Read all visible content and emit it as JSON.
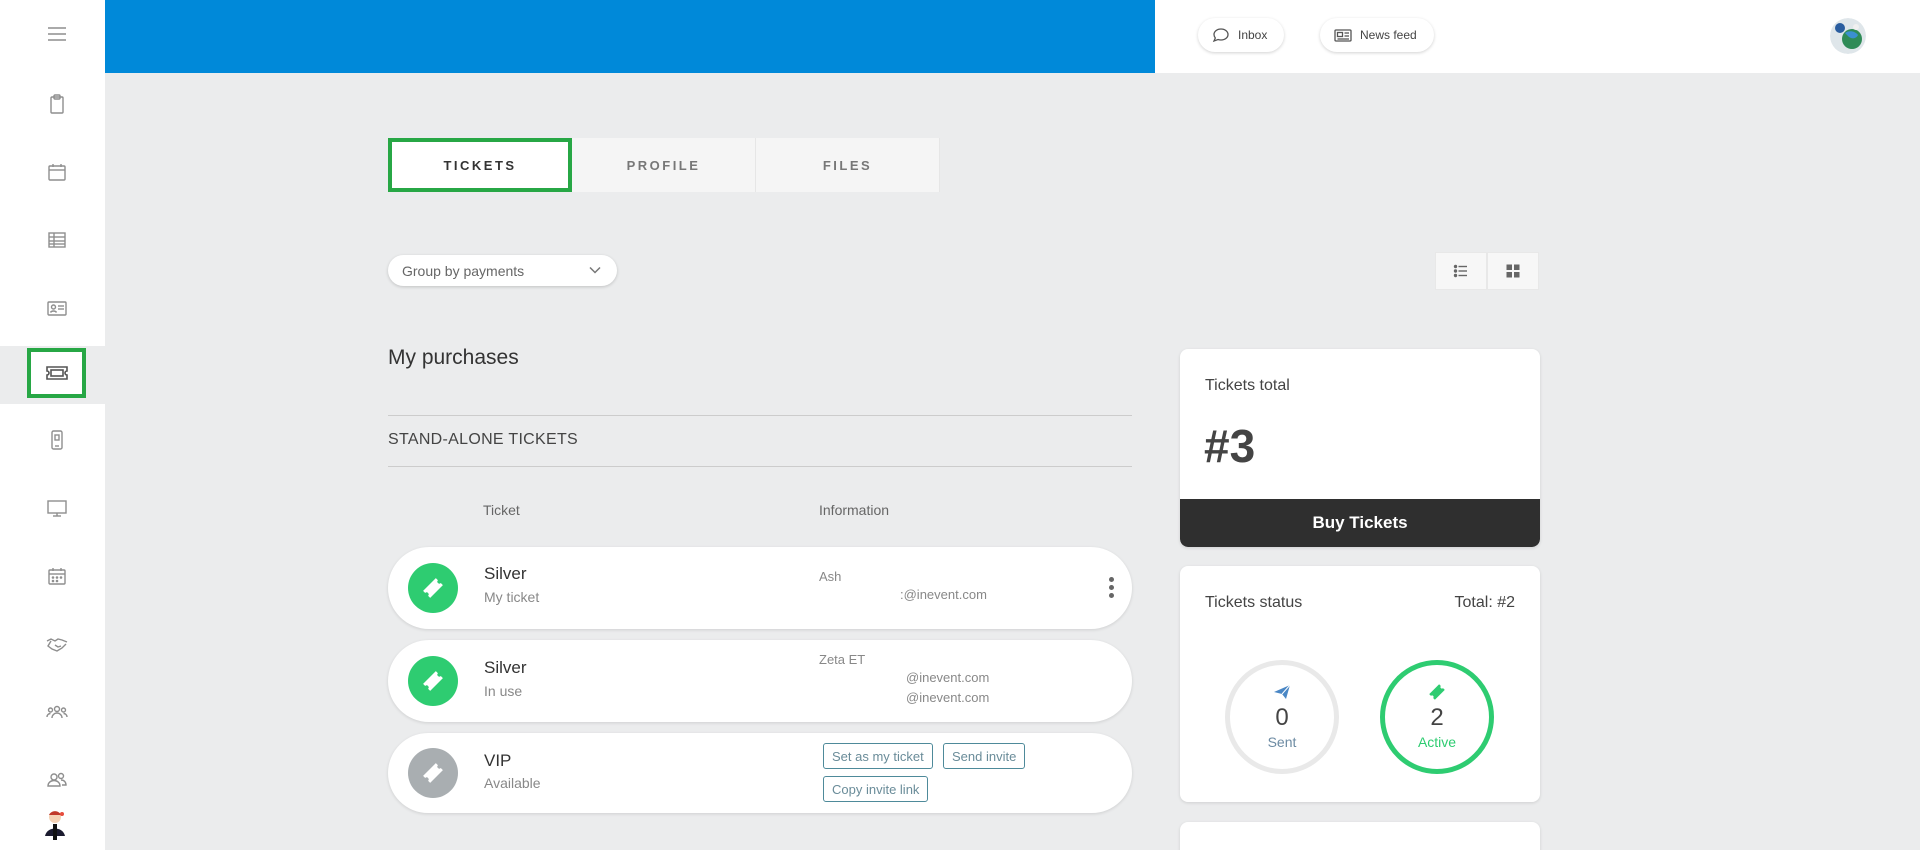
{
  "header": {
    "inbox_label": "Inbox",
    "newsfeed_label": "News feed",
    "banner_color": "#0089d9"
  },
  "sidebar": {
    "items": [
      {
        "name": "menu-icon"
      },
      {
        "name": "clipboard-icon"
      },
      {
        "name": "calendar-icon"
      },
      {
        "name": "table-icon"
      },
      {
        "name": "id-card-icon"
      },
      {
        "name": "ticket-icon",
        "active": true
      },
      {
        "name": "mobile-icon"
      },
      {
        "name": "monitor-icon"
      },
      {
        "name": "schedule-icon"
      },
      {
        "name": "handshake-icon"
      },
      {
        "name": "group-icon"
      },
      {
        "name": "users-icon"
      }
    ]
  },
  "tabs": [
    {
      "label": "TICKETS",
      "active": true
    },
    {
      "label": "PROFILE",
      "active": false
    },
    {
      "label": "FILES",
      "active": false
    }
  ],
  "groupby": {
    "value": "Group by payments"
  },
  "purchases": {
    "heading": "My purchases",
    "section_label": "STAND-ALONE TICKETS",
    "col_ticket": "Ticket",
    "col_information": "Information",
    "tickets": [
      {
        "name": "Silver",
        "status": "My ticket",
        "info_line1": "Ash",
        "info_line2": ":@inevent.com",
        "icon_color": "#2ecc71"
      },
      {
        "name": "Silver",
        "status": "In use",
        "info_line1": "Zeta ET",
        "info_line2": "@inevent.com",
        "info_line3": "@inevent.com",
        "icon_color": "#2ecc71"
      },
      {
        "name": "VIP",
        "status": "Available",
        "btn_set_my_ticket": "Set as my ticket",
        "btn_send_invite": "Send invite",
        "btn_copy_invite_link": "Copy invite link",
        "icon_color": "#a9aeb1"
      }
    ]
  },
  "tickets_total": {
    "title": "Tickets total",
    "value": "#3",
    "buy_label": "Buy Tickets"
  },
  "tickets_status": {
    "title": "Tickets status",
    "total": "Total: #2",
    "sent_count": "0",
    "sent_label": "Sent",
    "active_count": "2",
    "active_label": "Active",
    "active_color": "#2ecc71"
  }
}
